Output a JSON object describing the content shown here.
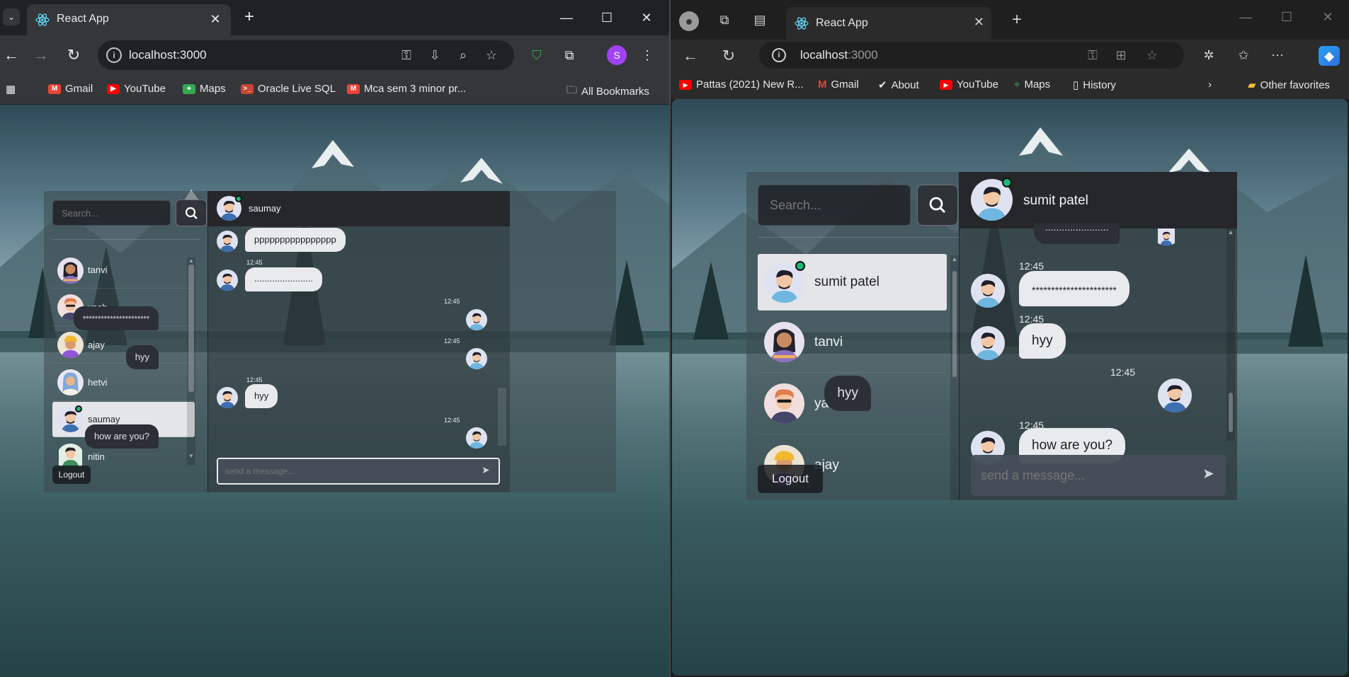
{
  "left_browser": {
    "tab_title": "React App",
    "url": "localhost:3000",
    "profile_initial": "S",
    "bookmarks": [
      "Gmail",
      "YouTube",
      "Maps",
      "Oracle Live SQL",
      "Mca sem 3 minor pr...",
      "All Bookmarks"
    ]
  },
  "right_browser": {
    "tab_title": "React App",
    "url_host": "localhost",
    "url_port": ":3000",
    "bookmarks": [
      "Pattas (2021) New R...",
      "Gmail",
      "About",
      "YouTube",
      "Maps",
      "History",
      "Other favorites"
    ]
  },
  "left_chat": {
    "search_placeholder": "Search...",
    "users": [
      {
        "name": "tanvi"
      },
      {
        "name": "yash"
      },
      {
        "name": "ajay"
      },
      {
        "name": "hetvi"
      },
      {
        "name": "saumay"
      },
      {
        "name": "nitin"
      }
    ],
    "logout_label": "Logout",
    "header_name": "saumay",
    "messages": [
      {
        "dir": "in",
        "time": "",
        "text": "pppppppppppppppp"
      },
      {
        "dir": "in",
        "time": "12:45",
        "text": "......................."
      },
      {
        "dir": "out",
        "time": "12:45",
        "text": "**********************"
      },
      {
        "dir": "out",
        "time": "12:45",
        "text": "hyy"
      },
      {
        "dir": "in",
        "time": "12:45",
        "text": "hyy"
      },
      {
        "dir": "out",
        "time": "12:45",
        "text": "how are you?"
      }
    ],
    "composer_placeholder": "send a message..."
  },
  "right_chat": {
    "search_placeholder": "Search...",
    "users": [
      {
        "name": "sumit patel"
      },
      {
        "name": "tanvi"
      },
      {
        "name": "yash"
      },
      {
        "name": "ajay"
      }
    ],
    "logout_label": "Logout",
    "header_name": "sumit patel",
    "messages": [
      {
        "dir": "out",
        "time": "",
        "text": "......................."
      },
      {
        "dir": "in",
        "time": "12:45",
        "text": "**********************"
      },
      {
        "dir": "in",
        "time": "12:45",
        "text": "hyy"
      },
      {
        "dir": "out",
        "time": "12:45",
        "text": "hyy"
      },
      {
        "dir": "in",
        "time": "12:45",
        "text": "how are you?"
      }
    ],
    "composer_placeholder": "send a message..."
  },
  "colors": {
    "online": "#17b978",
    "active_row": "#e4e5e8",
    "incoming_bubble": "#e8eaed",
    "outgoing_bubble": "#2c2f36",
    "header": "#26272b"
  }
}
